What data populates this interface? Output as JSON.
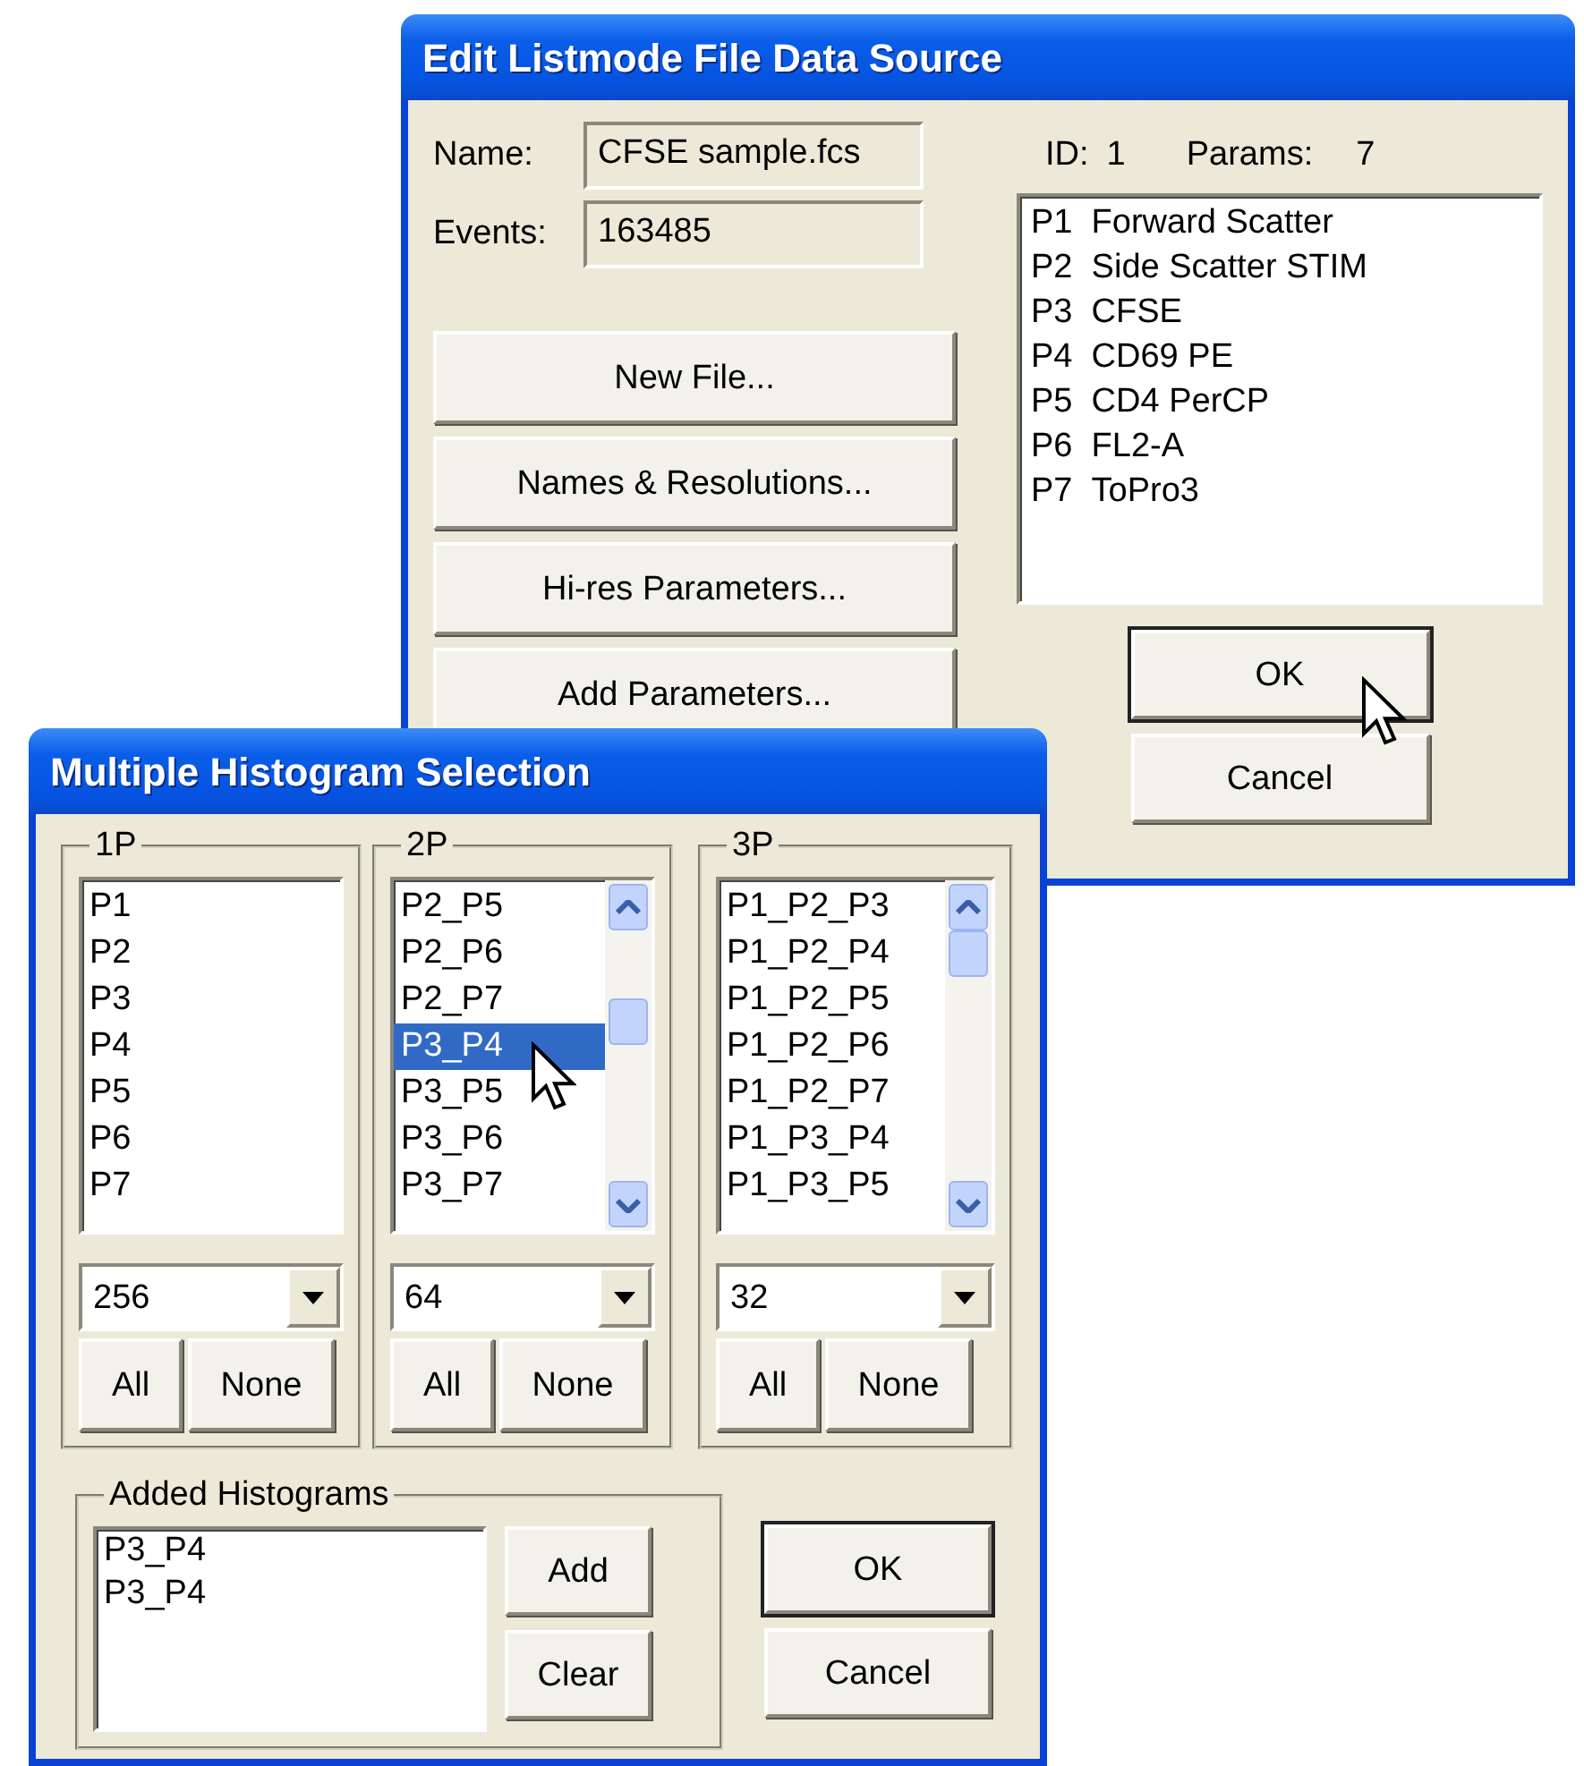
{
  "windows": [
    {
      "title": "Edit Listmode File Data Source",
      "fields": [
        {
          "label": "Name:",
          "value": "CFSE sample.fcs"
        },
        {
          "label": "Events:",
          "value": "163485"
        }
      ],
      "id_label": "ID:",
      "id_value": "1",
      "params_label": "Params:",
      "params_value": "7",
      "buttons": [
        "New File...",
        "Names & Resolutions...",
        "Hi-res Parameters...",
        "Add Parameters..."
      ],
      "parameters": [
        {
          "code": "P1",
          "name": "Forward Scatter"
        },
        {
          "code": "P2",
          "name": "Side Scatter STIM"
        },
        {
          "code": "P3",
          "name": "CFSE"
        },
        {
          "code": "P4",
          "name": "CD69 PE"
        },
        {
          "code": "P5",
          "name": "CD4 PerCP"
        },
        {
          "code": "P6",
          "name": "FL2-A"
        },
        {
          "code": "P7",
          "name": "ToPro3"
        }
      ],
      "dialog_buttons": [
        {
          "label": "OK",
          "default": true
        },
        {
          "label": "Cancel",
          "default": false
        }
      ]
    },
    {
      "title": "Multiple Histogram Selection",
      "groups": [
        {
          "label": "1P",
          "scrollbar": false,
          "items": [
            {
              "text": "P1",
              "selected": false
            },
            {
              "text": "P2",
              "selected": false
            },
            {
              "text": "P3",
              "selected": false
            },
            {
              "text": "P4",
              "selected": false
            },
            {
              "text": "P5",
              "selected": false
            },
            {
              "text": "P6",
              "selected": false
            },
            {
              "text": "P7",
              "selected": false
            }
          ],
          "resolution": "256",
          "buttons": [
            "All",
            "None"
          ]
        },
        {
          "label": "2P",
          "scrollbar": true,
          "items": [
            {
              "text": "P2_P5",
              "selected": false
            },
            {
              "text": "P2_P6",
              "selected": false
            },
            {
              "text": "P2_P7",
              "selected": false
            },
            {
              "text": "P3_P4",
              "selected": true
            },
            {
              "text": "P3_P5",
              "selected": false
            },
            {
              "text": "P3_P6",
              "selected": false
            },
            {
              "text": "P3_P7",
              "selected": false
            }
          ],
          "resolution": "64",
          "buttons": [
            "All",
            "None"
          ]
        },
        {
          "label": "3P",
          "scrollbar": true,
          "items": [
            {
              "text": "P1_P2_P3",
              "selected": false
            },
            {
              "text": "P1_P2_P4",
              "selected": false
            },
            {
              "text": "P1_P2_P5",
              "selected": false
            },
            {
              "text": "P1_P2_P6",
              "selected": false
            },
            {
              "text": "P1_P2_P7",
              "selected": false
            },
            {
              "text": "P1_P3_P4",
              "selected": false
            },
            {
              "text": "P1_P3_P5",
              "selected": false
            }
          ],
          "resolution": "32",
          "buttons": [
            "All",
            "None"
          ]
        }
      ],
      "added": {
        "label": "Added Histograms",
        "items": [
          "P3_P4",
          "P3_P4"
        ],
        "buttons": [
          "Add",
          "Clear"
        ]
      },
      "dialog_buttons": [
        {
          "label": "OK",
          "default": true
        },
        {
          "label": "Cancel",
          "default": false
        }
      ]
    }
  ]
}
